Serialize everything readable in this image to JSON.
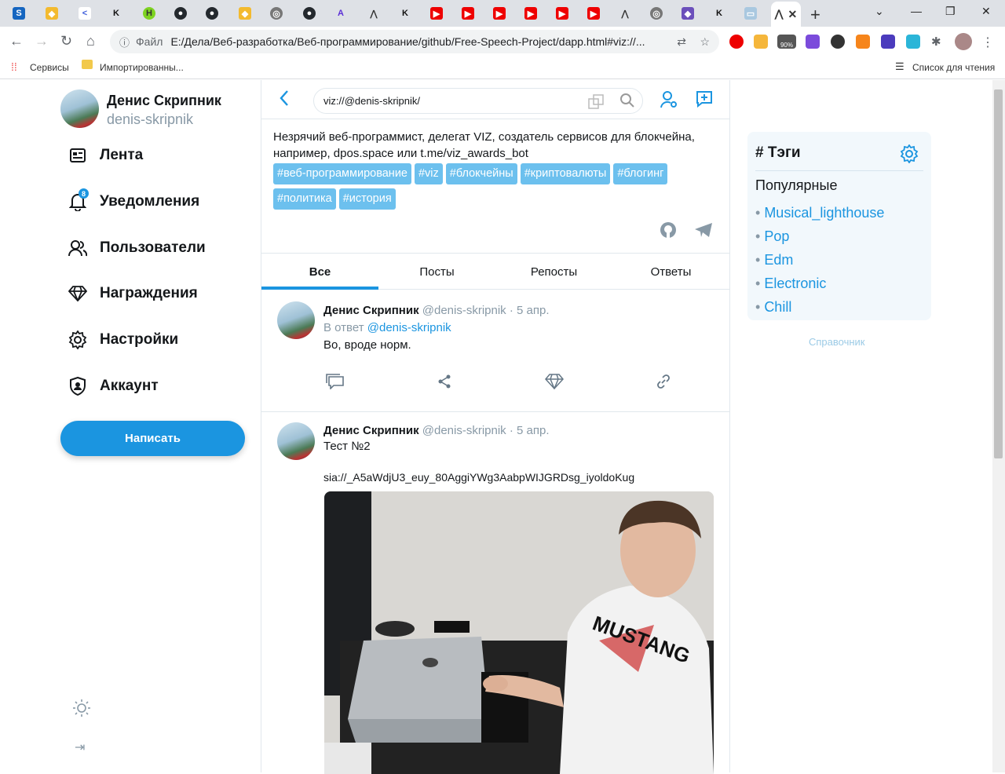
{
  "browser": {
    "address": "E:/Дела/Веб-разработка/Веб-программирование/github/Free-Speech-Project/dapp.html#viz://...",
    "file_label": "Файл",
    "bookmarks": {
      "services": "Сервисы",
      "imported": "Импортированны...",
      "reading_list": "Список для чтения"
    },
    "ext_badge": "90%"
  },
  "profile": {
    "name": "Денис Скрипник",
    "login": "denis-skripnik"
  },
  "nav": [
    {
      "label": "Лента",
      "icon": "feed-icon"
    },
    {
      "label": "Уведомления",
      "icon": "bell-icon",
      "badge": "8"
    },
    {
      "label": "Пользователи",
      "icon": "users-icon"
    },
    {
      "label": "Награждения",
      "icon": "diamond-icon"
    },
    {
      "label": "Настройки",
      "icon": "gear-icon"
    },
    {
      "label": "Аккаунт",
      "icon": "shield-icon"
    }
  ],
  "compose_label": "Написать",
  "search": {
    "value": "viz://@denis-skripnik/"
  },
  "bio": "Незрячий веб-программист, делегат VIZ, создатель сервисов для блокчейна, например, dpos.space или t.me/viz_awards_bot",
  "tags": [
    "#веб-программирование",
    "#viz",
    "#блокчейны",
    "#криптовалюты",
    "#блогинг",
    "#политика",
    "#история"
  ],
  "feed_tabs": [
    "Все",
    "Посты",
    "Репосты",
    "Ответы"
  ],
  "posts": [
    {
      "name": "Денис Скрипник",
      "handle": "@denis-skripnik",
      "date": "· 5 апр.",
      "reply_prefix": "В ответ",
      "reply_to": "@denis-skripnik",
      "text": "Во, вроде норм."
    },
    {
      "name": "Денис Скрипник",
      "handle": "@denis-skripnik",
      "date": "· 5 апр.",
      "title": "Тест №2",
      "text": "sia://_A5aWdjU3_euy_80AggiYWg3AabpWIJGRDsg_iyoldoKug"
    }
  ],
  "tagbox": {
    "title": "# Тэги",
    "popular": "Популярные",
    "items": [
      "Musical_lighthouse",
      "Pop",
      "Edm",
      "Electronic",
      "Chill"
    ]
  },
  "reference": "Справочник",
  "colors": {
    "accent": "#1b95e0",
    "tag_bg": "#6cc0ee",
    "muted": "#8899a6"
  }
}
